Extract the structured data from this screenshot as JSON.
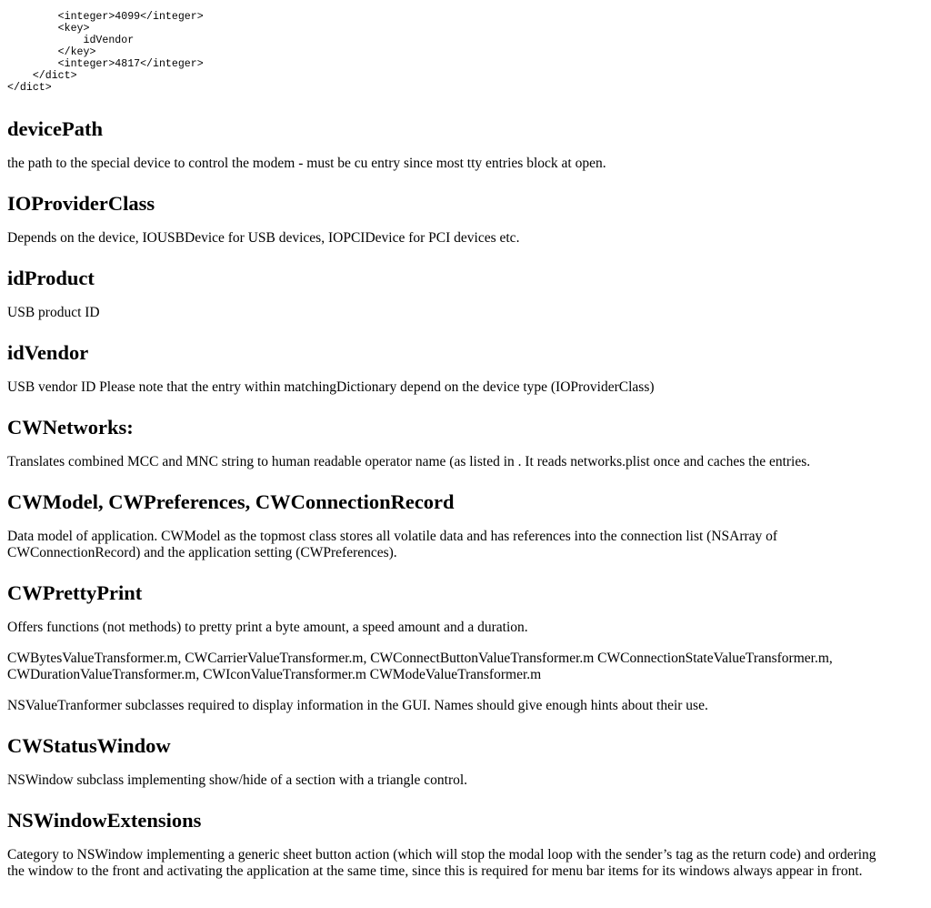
{
  "code_lines": [
    "        <integer>4099</integer>",
    "        <key>",
    "            idVendor",
    "        </key>",
    "        <integer>4817</integer>",
    "    </dict>",
    "</dict>"
  ],
  "sections": {
    "devicePath": {
      "title": "devicePath",
      "text": "the path to the special device to control the modem - must be cu entry since most tty entries block at open."
    },
    "ioProviderClass": {
      "title": "IOProviderClass",
      "text": "Depends on the device, IOUSBDevice for USB devices, IOPCIDevice for PCI devices etc."
    },
    "idProduct": {
      "title": "idProduct",
      "text": "USB product ID"
    },
    "idVendor": {
      "title": "idVendor",
      "text": "USB vendor ID Please note that the entry within matchingDictionary depend on the device type (IOProviderClass)"
    },
    "cwNetworks": {
      "title": "CWNetworks:",
      "text": "Translates combined MCC and MNC string to human readable operator name (as listed in . It reads networks.plist once and caches the entries."
    },
    "cwModel": {
      "title": "CWModel, CWPreferences, CWConnectionRecord",
      "text_line1": "Data model of application. CWModel as the topmost class stores all volatile data and has references into the connection list (NSArray of",
      "text_line2": "CWConnectionRecord) and the application setting (CWPreferences)."
    },
    "cwPrettyPrint": {
      "title": "CWPrettyPrint",
      "text": "Offers functions (not methods) to pretty print a byte amount, a speed amount and a duration.",
      "files_line1": "CWBytesValueTransformer.m, CWCarrierValueTransformer.m, CWConnectButtonValueTransformer.m CWConnectionStateValueTransformer.m,",
      "files_line2": "CWDurationValueTransformer.m, CWIconValueTransformer.m CWModeValueTransformer.m",
      "note": "NSValueTranformer subclasses required to display information in the GUI. Names should give enough hints about their use."
    },
    "cwStatusWindow": {
      "title": "CWStatusWindow",
      "text": "NSWindow subclass implementing show/hide of a section with a triangle control."
    },
    "nsWindowExtensions": {
      "title": "NSWindowExtensions",
      "text_line1": "Category to NSWindow implementing a generic sheet button action (which will stop the modal loop with the sender’s tag as the return code) and ordering",
      "text_line2": "the window to the front and activating the application at the same time, since this is required for menu bar items for its windows always appear in front."
    }
  }
}
